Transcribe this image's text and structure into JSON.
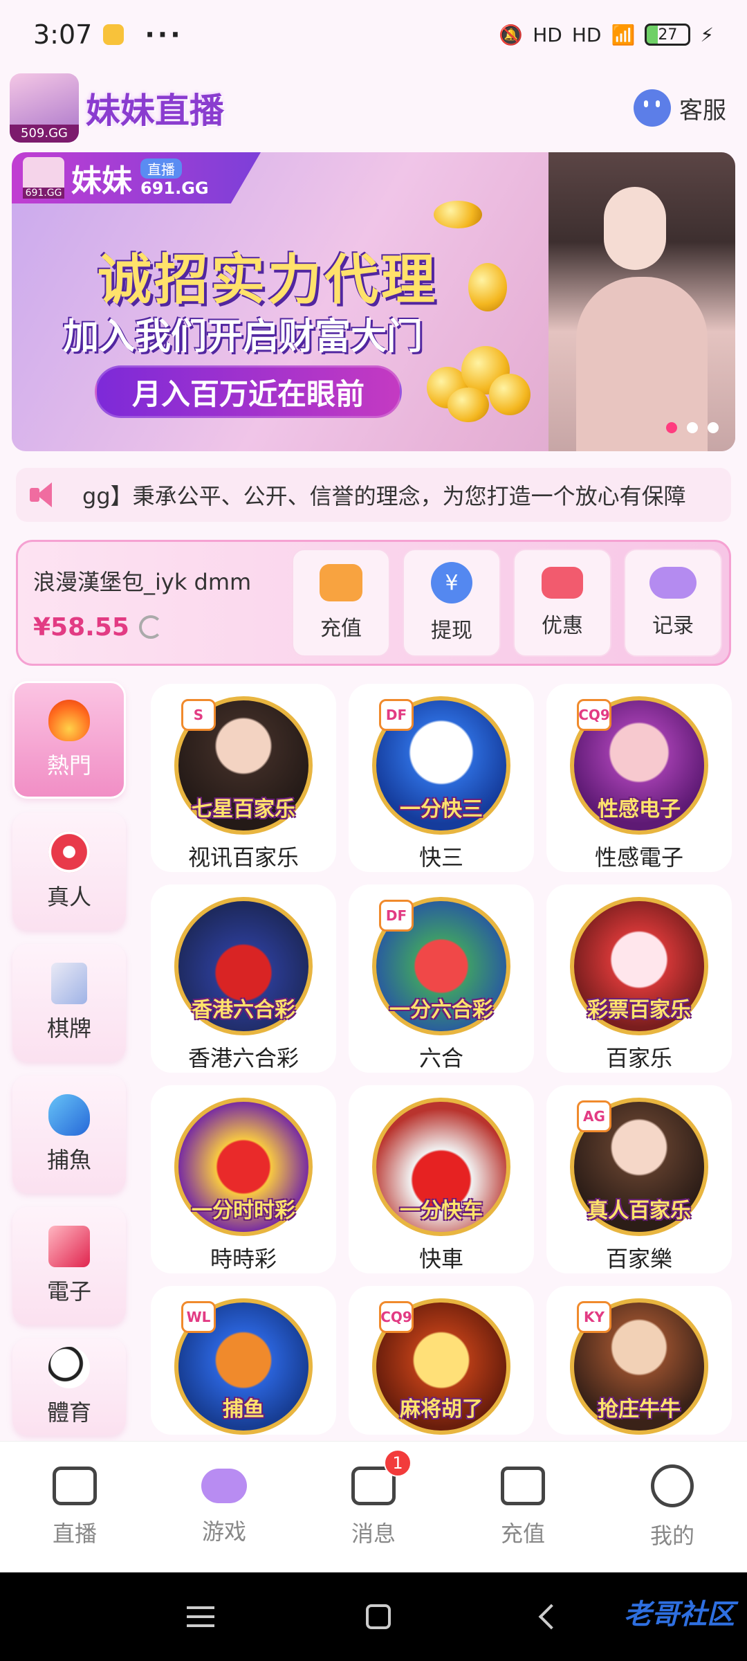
{
  "status_bar": {
    "time": "3:07",
    "dots": "···",
    "network1": "HD",
    "network2": "HD",
    "battery": "27"
  },
  "header": {
    "logo_domain": "509.GG",
    "title": "妹妹直播",
    "customer_service_label": "客服"
  },
  "banner": {
    "brand_name": "妹妹",
    "brand_tag": "直播",
    "brand_domain": "691.GG",
    "mini_logo_domain": "691.GG",
    "line1": "诚招实力代理",
    "line2": "加入我们开启财富大门",
    "line3": "月入百万近在眼前",
    "slides": 3,
    "active_slide": 1
  },
  "marquee": {
    "text": "gg】秉承公平、公开、信誉的理念，为您打造一个放心有保障"
  },
  "wallet": {
    "username": "浪漫漢堡包_iyk dmm",
    "balance": "¥58.55",
    "actions": [
      {
        "label": "充值",
        "icon": "wallet-icon"
      },
      {
        "label": "提现",
        "icon": "yen-icon"
      },
      {
        "label": "优惠",
        "icon": "ticket-icon"
      },
      {
        "label": "记录",
        "icon": "gamepad-icon"
      }
    ]
  },
  "categories": [
    {
      "label": "熱門",
      "icon": "fire-icon"
    },
    {
      "label": "真人",
      "icon": "chip-icon"
    },
    {
      "label": "棋牌",
      "icon": "cards-icon"
    },
    {
      "label": "捕魚",
      "icon": "fish-icon"
    },
    {
      "label": "電子",
      "icon": "slots-icon"
    },
    {
      "label": "體育",
      "icon": "soccer-icon"
    }
  ],
  "games": [
    {
      "name": "视讯百家乐",
      "art_label": "七星百家乐",
      "badge": "S"
    },
    {
      "name": "快三",
      "art_label": "一分快三",
      "badge": "DF"
    },
    {
      "name": "性感電子",
      "art_label": "性感电子",
      "badge": "CQ9"
    },
    {
      "name": "香港六合彩",
      "art_label": "香港六合彩",
      "badge": ""
    },
    {
      "name": "六合",
      "art_label": "一分六合彩",
      "badge": "DF"
    },
    {
      "name": "百家乐",
      "art_label": "彩票百家乐",
      "badge": ""
    },
    {
      "name": "時時彩",
      "art_label": "一分时时彩",
      "badge": ""
    },
    {
      "name": "快車",
      "art_label": "一分快车",
      "badge": ""
    },
    {
      "name": "百家樂",
      "art_label": "真人百家乐",
      "badge": "AG"
    },
    {
      "name": "",
      "art_label": "捕鱼",
      "badge": "WL"
    },
    {
      "name": "",
      "art_label": "麻将胡了",
      "badge": "CQ9"
    },
    {
      "name": "",
      "art_label": "抢庄牛牛",
      "badge": "KY"
    }
  ],
  "tabbar": {
    "tabs": [
      {
        "label": "直播",
        "icon": "video-camera-icon"
      },
      {
        "label": "游戏",
        "icon": "gamepad-icon"
      },
      {
        "label": "消息",
        "icon": "message-icon",
        "badge": "1"
      },
      {
        "label": "充值",
        "icon": "wallet-icon"
      },
      {
        "label": "我的",
        "icon": "smiley-icon"
      }
    ],
    "active": "游戏"
  },
  "watermark": "老哥社区"
}
